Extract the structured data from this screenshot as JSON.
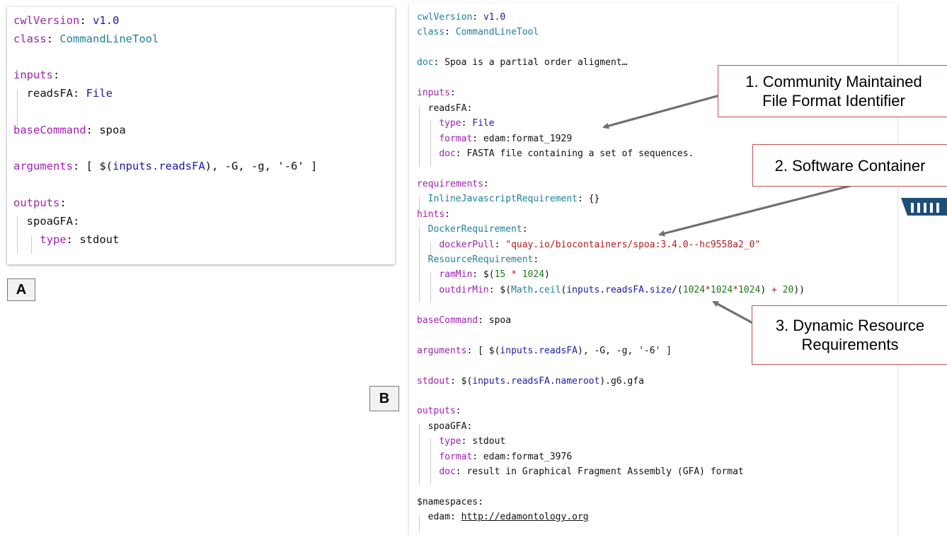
{
  "panel_a": {
    "label": "A",
    "lines": [
      [
        {
          "t": "cwlVersion",
          "c": "k"
        },
        {
          "t": ": ",
          "c": "p"
        },
        {
          "t": "v1.0",
          "c": "n"
        }
      ],
      [
        {
          "t": "class",
          "c": "k"
        },
        {
          "t": ": ",
          "c": "p"
        },
        {
          "t": "CommandLineTool",
          "c": "t"
        }
      ],
      [],
      [
        {
          "t": "inputs",
          "c": "k"
        },
        {
          "t": ":",
          "c": "p"
        }
      ],
      [
        {
          "t": "  readsFA: ",
          "c": "p"
        },
        {
          "t": "File",
          "c": "n"
        }
      ],
      [],
      [
        {
          "t": "baseCommand",
          "c": "k"
        },
        {
          "t": ": spoa",
          "c": "p"
        }
      ],
      [],
      [
        {
          "t": "arguments",
          "c": "k"
        },
        {
          "t": ": [ $(",
          "c": "p"
        },
        {
          "t": "inputs.readsFA",
          "c": "n"
        },
        {
          "t": "), -G, -g, '-6' ]",
          "c": "p"
        }
      ],
      [],
      [
        {
          "t": "outputs",
          "c": "k"
        },
        {
          "t": ":",
          "c": "p"
        }
      ],
      [
        {
          "t": "  spoaGFA:",
          "c": "p"
        }
      ],
      [
        {
          "t": "    ",
          "c": "p"
        },
        {
          "t": "type",
          "c": "k"
        },
        {
          "t": ": stdout",
          "c": "p"
        }
      ]
    ]
  },
  "panel_b": {
    "label": "B",
    "lines": [
      [
        {
          "t": "cwlVersion",
          "c": "t"
        },
        {
          "t": ": ",
          "c": "p"
        },
        {
          "t": "v1.0",
          "c": "n"
        }
      ],
      [
        {
          "t": "class",
          "c": "t"
        },
        {
          "t": ": ",
          "c": "p"
        },
        {
          "t": "CommandLineTool",
          "c": "t"
        }
      ],
      [],
      [
        {
          "t": "doc",
          "c": "t"
        },
        {
          "t": ": Spoa is a partial order aligment…",
          "c": "p"
        }
      ],
      [],
      [
        {
          "t": "inputs",
          "c": "k"
        },
        {
          "t": ":",
          "c": "p"
        }
      ],
      [
        {
          "t": "  readsFA:",
          "c": "p"
        }
      ],
      [
        {
          "t": "    ",
          "c": "p"
        },
        {
          "t": "type",
          "c": "k"
        },
        {
          "t": ": ",
          "c": "p"
        },
        {
          "t": "File",
          "c": "n"
        }
      ],
      [
        {
          "t": "    ",
          "c": "p"
        },
        {
          "t": "format",
          "c": "k"
        },
        {
          "t": ": edam:format_1929",
          "c": "p"
        }
      ],
      [
        {
          "t": "    ",
          "c": "p"
        },
        {
          "t": "doc",
          "c": "k"
        },
        {
          "t": ": FASTA file containing a set of sequences.",
          "c": "p"
        }
      ],
      [],
      [
        {
          "t": "requirements",
          "c": "k"
        },
        {
          "t": ":",
          "c": "p"
        }
      ],
      [
        {
          "t": "  ",
          "c": "p"
        },
        {
          "t": "InlineJavascriptRequirement",
          "c": "t"
        },
        {
          "t": ": {}",
          "c": "p"
        }
      ],
      [
        {
          "t": "hints",
          "c": "k"
        },
        {
          "t": ":",
          "c": "p"
        }
      ],
      [
        {
          "t": "  ",
          "c": "p"
        },
        {
          "t": "DockerRequirement",
          "c": "t"
        },
        {
          "t": ":",
          "c": "p"
        }
      ],
      [
        {
          "t": "    ",
          "c": "p"
        },
        {
          "t": "dockerPull",
          "c": "k"
        },
        {
          "t": ": ",
          "c": "p"
        },
        {
          "t": "\"quay.io/biocontainers/spoa:3.4.0--hc9558a2_0\"",
          "c": "s"
        }
      ],
      [
        {
          "t": "  ",
          "c": "p"
        },
        {
          "t": "ResourceRequirement",
          "c": "t"
        },
        {
          "t": ":",
          "c": "p"
        }
      ],
      [
        {
          "t": "    ",
          "c": "p"
        },
        {
          "t": "ramMin",
          "c": "k"
        },
        {
          "t": ": $(",
          "c": "p"
        },
        {
          "t": "15",
          "c": "g"
        },
        {
          "t": " * ",
          "c": "s"
        },
        {
          "t": "1024",
          "c": "g"
        },
        {
          "t": ")",
          "c": "p"
        }
      ],
      [
        {
          "t": "    ",
          "c": "p"
        },
        {
          "t": "outdirMin",
          "c": "k"
        },
        {
          "t": ": $(",
          "c": "p"
        },
        {
          "t": "Math",
          "c": "t"
        },
        {
          "t": ".",
          "c": "p"
        },
        {
          "t": "ceil",
          "c": "t"
        },
        {
          "t": "(",
          "c": "p"
        },
        {
          "t": "inputs",
          "c": "n"
        },
        {
          "t": ".",
          "c": "p"
        },
        {
          "t": "readsFA",
          "c": "n"
        },
        {
          "t": ".",
          "c": "p"
        },
        {
          "t": "size",
          "c": "n"
        },
        {
          "t": "/(",
          "c": "p"
        },
        {
          "t": "1024",
          "c": "g"
        },
        {
          "t": "*",
          "c": "s"
        },
        {
          "t": "1024",
          "c": "g"
        },
        {
          "t": "*",
          "c": "s"
        },
        {
          "t": "1024",
          "c": "g"
        },
        {
          "t": ") ",
          "c": "p"
        },
        {
          "t": "+",
          "c": "s"
        },
        {
          "t": " ",
          "c": "p"
        },
        {
          "t": "20",
          "c": "g"
        },
        {
          "t": "))",
          "c": "p"
        }
      ],
      [],
      [
        {
          "t": "baseCommand",
          "c": "k"
        },
        {
          "t": ": spoa",
          "c": "p"
        }
      ],
      [],
      [
        {
          "t": "arguments",
          "c": "k"
        },
        {
          "t": ": [ $(",
          "c": "p"
        },
        {
          "t": "inputs.readsFA",
          "c": "n"
        },
        {
          "t": "), -G, -g, '-6' ]",
          "c": "p"
        }
      ],
      [],
      [
        {
          "t": "stdout",
          "c": "k"
        },
        {
          "t": ": $(",
          "c": "p"
        },
        {
          "t": "inputs.readsFA.nameroot",
          "c": "n"
        },
        {
          "t": ").g6.gfa",
          "c": "p"
        }
      ],
      [],
      [
        {
          "t": "outputs",
          "c": "k"
        },
        {
          "t": ":",
          "c": "p"
        }
      ],
      [
        {
          "t": "  spoaGFA:",
          "c": "p"
        }
      ],
      [
        {
          "t": "    ",
          "c": "p"
        },
        {
          "t": "type",
          "c": "k"
        },
        {
          "t": ": stdout",
          "c": "p"
        }
      ],
      [
        {
          "t": "    ",
          "c": "p"
        },
        {
          "t": "format",
          "c": "k"
        },
        {
          "t": ": edam:format_3976",
          "c": "p"
        }
      ],
      [
        {
          "t": "    ",
          "c": "p"
        },
        {
          "t": "doc",
          "c": "k"
        },
        {
          "t": ": result in Graphical Fragment Assembly (GFA) format",
          "c": "p"
        }
      ],
      [],
      [
        {
          "t": "$namespaces:",
          "c": "p"
        }
      ],
      [
        {
          "t": "  edam: ",
          "c": "p"
        },
        {
          "t": "http://edamontology.org",
          "c": "u"
        }
      ]
    ]
  },
  "callouts": {
    "c1": {
      "line1": "1. Community Maintained",
      "line2": "File Format Identifier"
    },
    "c2": {
      "line1": "2. Software Container"
    },
    "c3": {
      "line1": "3. Dynamic Resource",
      "line2": "Requirements"
    }
  },
  "icons": {
    "container": "shipping-container-icon"
  },
  "colors": {
    "keyword": "#a020b0",
    "type": "#1f7f9a",
    "value": "#1a1aa6",
    "string": "#b01c1c",
    "number": "#1a7a1a",
    "callout_border": "#c0504d",
    "arrow": "#707070",
    "container_icon": "#1f4e79"
  }
}
